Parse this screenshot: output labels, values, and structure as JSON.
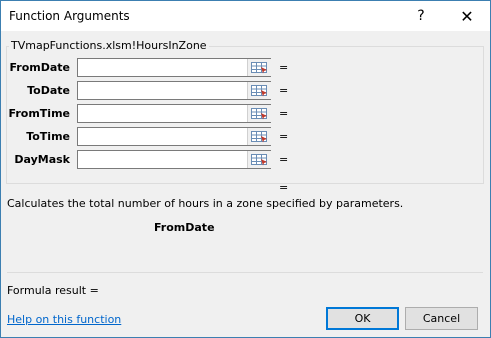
{
  "window": {
    "title": "Function Arguments",
    "help_glyph": "?",
    "close_glyph": "✕"
  },
  "function": {
    "group_title": "TVmapFunctions.xlsm!HoursInZone",
    "args": [
      {
        "label": "FromDate",
        "value": "",
        "equals": "="
      },
      {
        "label": "ToDate",
        "value": "",
        "equals": "="
      },
      {
        "label": "FromTime",
        "value": "",
        "equals": "="
      },
      {
        "label": "ToTime",
        "value": "",
        "equals": "="
      },
      {
        "label": "DayMask",
        "value": "",
        "equals": "="
      }
    ],
    "result_equals": "=",
    "description": "Calculates the total number of hours in a zone specified by parameters.",
    "current_arg": "FromDate"
  },
  "footer": {
    "formula_result": "Formula result =",
    "help_link": "Help on this function",
    "ok_label": "OK",
    "cancel_label": "Cancel"
  },
  "colors": {
    "window_border": "#3c7fb1",
    "link": "#0066cc",
    "ok_border": "#0078d7"
  }
}
